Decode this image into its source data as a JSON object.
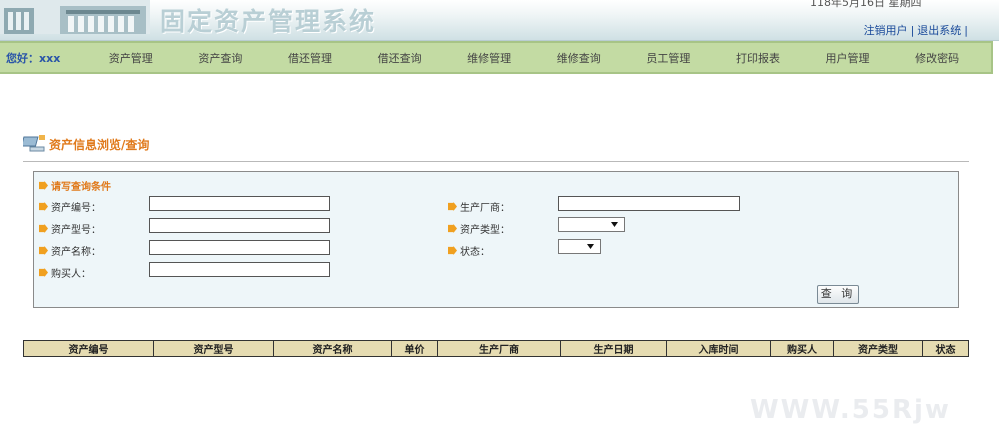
{
  "header": {
    "app_title": "固定资产管理系统",
    "date_text": "118年5月16日 星期四",
    "logout_user_label": "注销用户",
    "separator": "|",
    "exit_label": "退出系统",
    "trailing_sep": "|"
  },
  "nav": {
    "greeting": "您好：xxx",
    "items": [
      "资产管理",
      "资产查询",
      "借还管理",
      "借还查询",
      "维修管理",
      "维修查询",
      "员工管理",
      "打印报表",
      "用户管理",
      "修改密码"
    ]
  },
  "section": {
    "title": "资产信息浏览/查询"
  },
  "search": {
    "heading": "请写查询条件",
    "asset_no_label": "资产编号：",
    "asset_model_label": "资产型号：",
    "asset_name_label": "资产名称：",
    "buyer_label": "购买人：",
    "maker_label": "生产厂商：",
    "asset_type_label": "资产类型：",
    "status_label": "状态：",
    "asset_type_value": "",
    "status_value": "",
    "query_button": "查 询"
  },
  "table": {
    "columns": [
      "资产编号",
      "资产型号",
      "资产名称",
      "单价",
      "生产厂商",
      "生产日期",
      "入库时间",
      "购买人",
      "资产类型",
      "状态"
    ]
  },
  "watermark": "WWW.55Rjw"
}
